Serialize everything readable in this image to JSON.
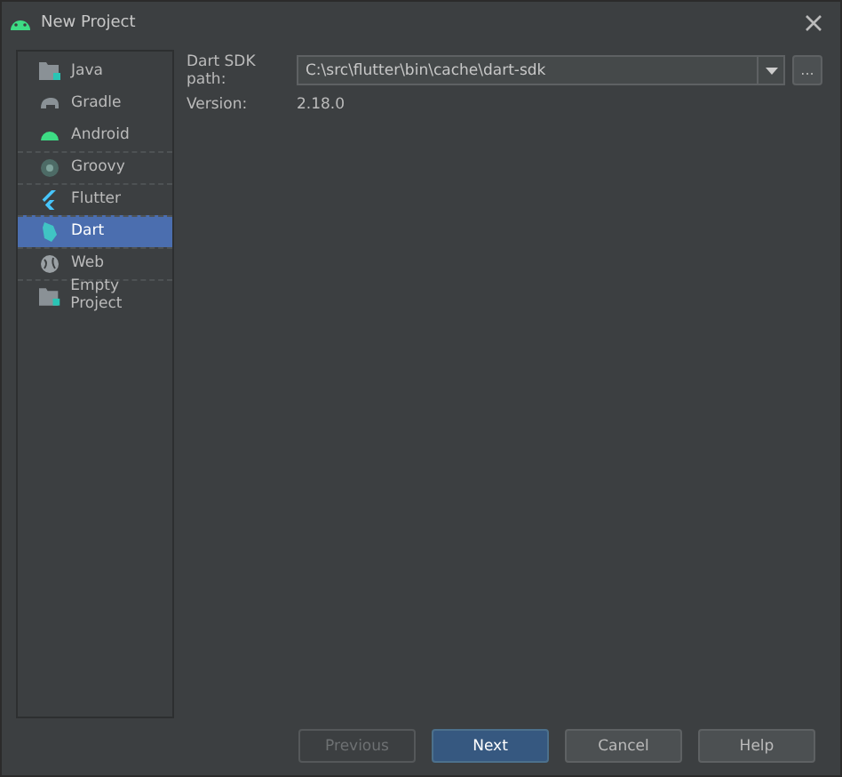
{
  "window": {
    "title": "New Project"
  },
  "sidebar": {
    "items": [
      {
        "label": "Java",
        "selected": false
      },
      {
        "label": "Gradle",
        "selected": false
      },
      {
        "label": "Android",
        "selected": false
      },
      {
        "label": "Groovy",
        "selected": false
      },
      {
        "label": "Flutter",
        "selected": false
      },
      {
        "label": "Dart",
        "selected": true
      },
      {
        "label": "Web",
        "selected": false
      },
      {
        "label": "Empty Project",
        "selected": false
      }
    ]
  },
  "form": {
    "sdk_label": "Dart SDK path:",
    "sdk_value": "C:\\src\\flutter\\bin\\cache\\dart-sdk",
    "browse": "...",
    "version_label": "Version:",
    "version_value": "2.18.0"
  },
  "buttons": [
    {
      "label": "Previous",
      "disabled": true,
      "default": false
    },
    {
      "label": "Next",
      "disabled": false,
      "default": true
    },
    {
      "label": "Cancel",
      "disabled": false,
      "default": false
    },
    {
      "label": "Help",
      "disabled": false,
      "default": false
    }
  ]
}
